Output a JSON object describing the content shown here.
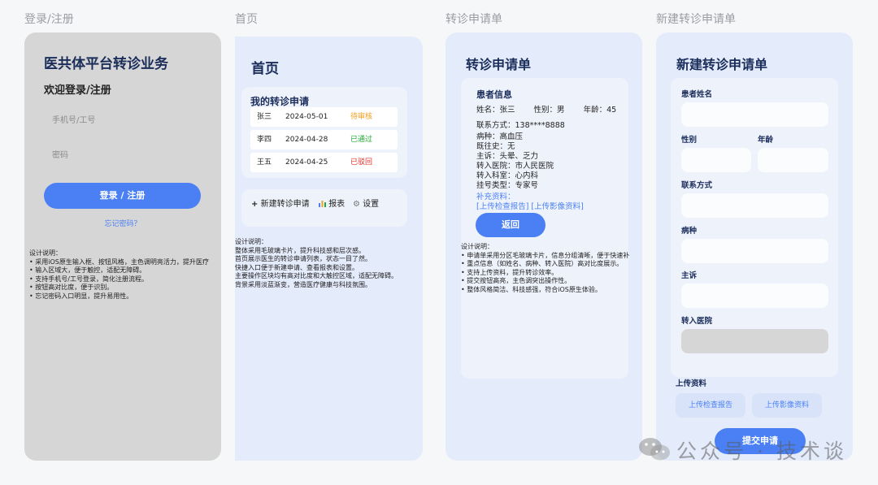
{
  "labels": {
    "login": "登录/注册",
    "home": "首页",
    "referral": "转诊申请单",
    "new_referral": "新建转诊申请单"
  },
  "login": {
    "title": "医共体平台转诊业务",
    "subtitle": "欢迎登录/注册",
    "phone_placeholder": "手机号/工号",
    "password_placeholder": "密码",
    "button": "登录 / 注册",
    "forgot": "忘记密码？",
    "notes": [
      "设计说明：",
      "• 采用iOS原生输入框、按钮风格，主色调明亮活力，提升医疗",
      "• 输入区域大，便于触控，适配无障碍。",
      "• 支持手机号/工号登录，简化注册流程。",
      "• 按钮高对比度，便于识别。",
      "• 忘记密码入口明显，提升易用性。"
    ]
  },
  "home": {
    "title": "首页",
    "card_title": "我的转诊申请",
    "rows": [
      {
        "name": "张三",
        "date": "2024-05-01",
        "status": "待审核",
        "color": "#f0a020"
      },
      {
        "name": "李四",
        "date": "2024-04-28",
        "status": "已通过",
        "color": "#22a838"
      },
      {
        "name": "王五",
        "date": "2024-04-25",
        "status": "已驳回",
        "color": "#e0302a"
      }
    ],
    "toolbar": {
      "new": "新建转诊申请",
      "report": "报表",
      "settings": "设置"
    },
    "notes": [
      "设计说明：",
      "整体采用毛玻璃卡片，提升科技感和层次感。",
      "首页展示医生的转诊申请列表，状态一目了然。",
      "快捷入口便于新建申请、查看报表和设置。",
      "主要操作区块均有高对比度和大触控区域，适配无障碍。",
      "背景采用淡蓝渐变，营造医疗健康与科技氛围。"
    ]
  },
  "referral": {
    "title": "转诊申请单",
    "section": "患者信息",
    "name": "姓名：张三",
    "gender": "性别：男",
    "age": "年龄：45",
    "lines": [
      "联系方式：138****8888",
      "病种：高血压",
      "既往史：无",
      "主诉：头晕、乏力",
      "转入医院：市人民医院",
      "转入科室：心内科",
      "挂号类型：专家号"
    ],
    "supplement": "补充资料：",
    "upload_links": "[上传检查报告] [上传影像资料]",
    "button": "返回",
    "notes": [
      "设计说明：",
      "• 申请单采用分区毛玻璃卡片，信息分组清晰，便于快速补",
      "• 重点信息（如姓名、病种、转入医院）高对比度展示。",
      "• 支持上传资料，提升转诊效率。",
      "• 提交按钮高亮，主色调突出操作性。",
      "• 整体风格简洁、科技感强，符合iOS原生体验。"
    ]
  },
  "new_referral": {
    "title": "新建转诊申请单",
    "fields": {
      "patient_name": "患者姓名",
      "gender": "性别",
      "age": "年龄",
      "contact": "联系方式",
      "disease": "病种",
      "complaint": "主诉",
      "hospital": "转入医院"
    },
    "upload_title": "上传资料",
    "upload_report": "上传检查报告",
    "upload_image": "上传影像资料",
    "submit": "提交申请"
  },
  "watermark": "公众号 · 技术谈",
  "colors": {
    "primary": "#4b80f5",
    "title": "#1a2d5a"
  }
}
